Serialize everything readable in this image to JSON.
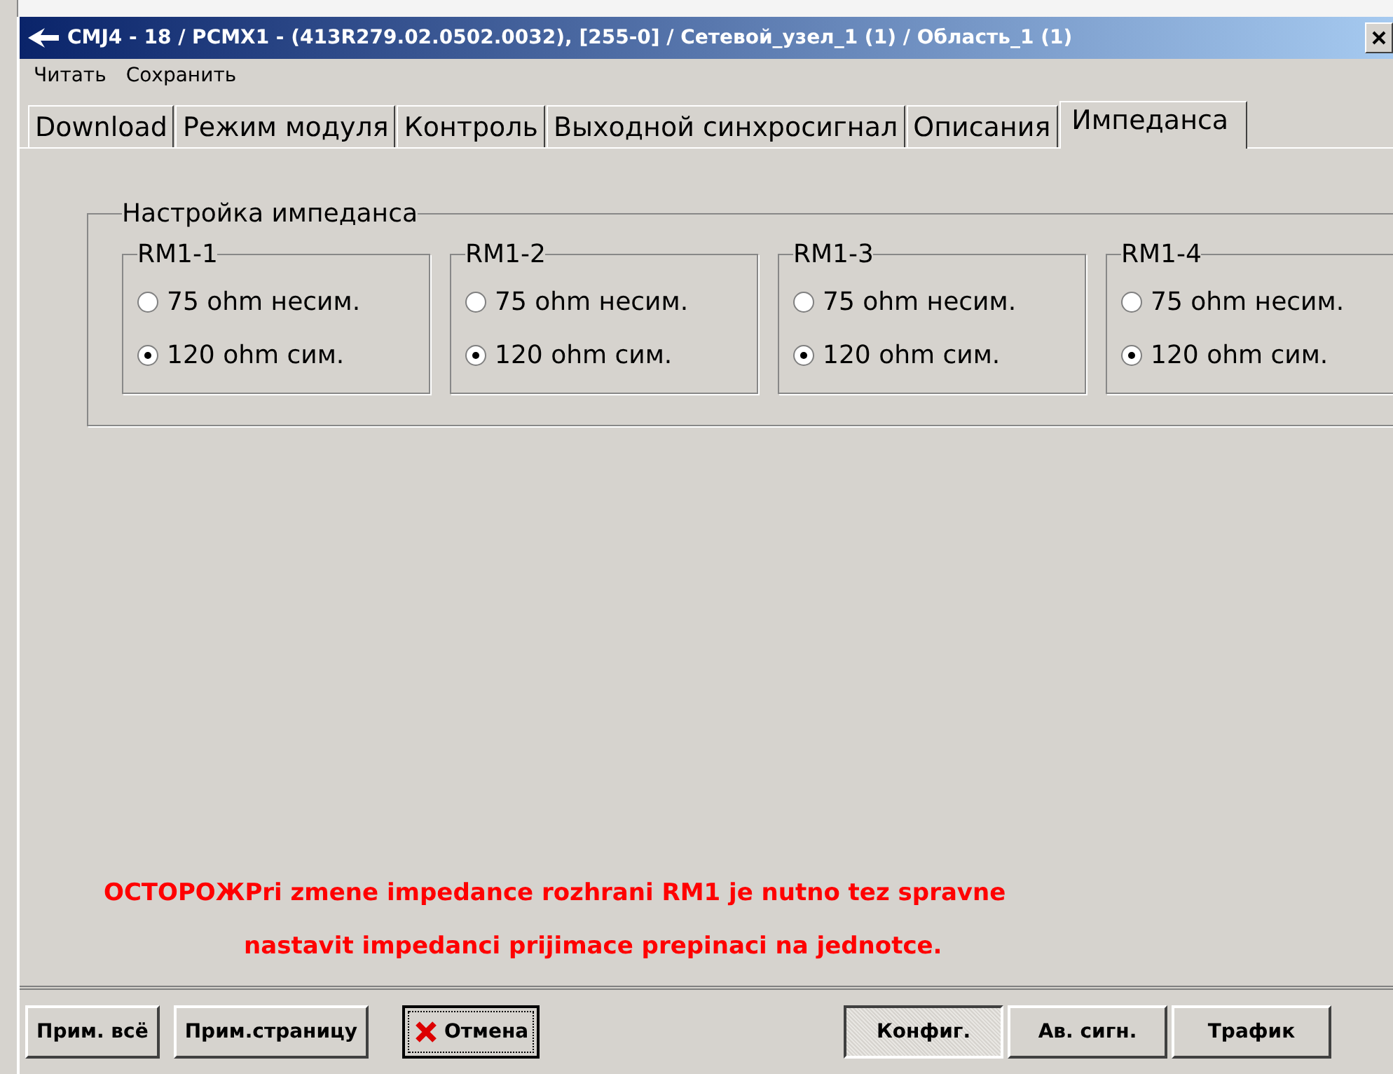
{
  "window": {
    "title": "CMJ4 - 18 / PCMX1 - (413R279.02.0502.0032), [255-0] / Сетевой_узел_1 (1) / Область_1 (1)"
  },
  "menu": [
    "Читать",
    "Сохранить"
  ],
  "tabs": [
    {
      "label": "Download",
      "selected": false
    },
    {
      "label": "Режим модуля",
      "selected": false
    },
    {
      "label": "Контроль",
      "selected": false
    },
    {
      "label": "Выходной синхросигнал",
      "selected": false
    },
    {
      "label": "Описания",
      "selected": false
    },
    {
      "label": "Импеданса",
      "selected": true
    }
  ],
  "impedance_group": {
    "title": "Настройка импеданса",
    "ports": [
      {
        "name": "RM1-1",
        "options": [
          {
            "label": "75 ohm несим.",
            "selected": false
          },
          {
            "label": "120 ohm сим.",
            "selected": true
          }
        ]
      },
      {
        "name": "RM1-2",
        "options": [
          {
            "label": "75 ohm несим.",
            "selected": false
          },
          {
            "label": "120 ohm сим.",
            "selected": true
          }
        ]
      },
      {
        "name": "RM1-3",
        "options": [
          {
            "label": "75 ohm несим.",
            "selected": false
          },
          {
            "label": "120 ohm сим.",
            "selected": true
          }
        ]
      },
      {
        "name": "RM1-4",
        "options": [
          {
            "label": "75 ohm несим.",
            "selected": false
          },
          {
            "label": "120 ohm сим.",
            "selected": true
          }
        ]
      }
    ]
  },
  "warning": [
    "ОСТОРОЖPri zmene impedance rozhrani RM1 je nutno tez spravne",
    "nastavit impedanci prijimace prepinaci na jednotce."
  ],
  "actions": [
    {
      "label": "Прим. всё",
      "kind": "plain"
    },
    {
      "label": "Прим.страницу",
      "kind": "plain"
    },
    {
      "label": "Отмена",
      "kind": "cancel"
    }
  ],
  "views": [
    {
      "label": "Конфиг.",
      "selected": true
    },
    {
      "label": "Ав. сигн.",
      "selected": false
    },
    {
      "label": "Трафик",
      "selected": false
    }
  ]
}
